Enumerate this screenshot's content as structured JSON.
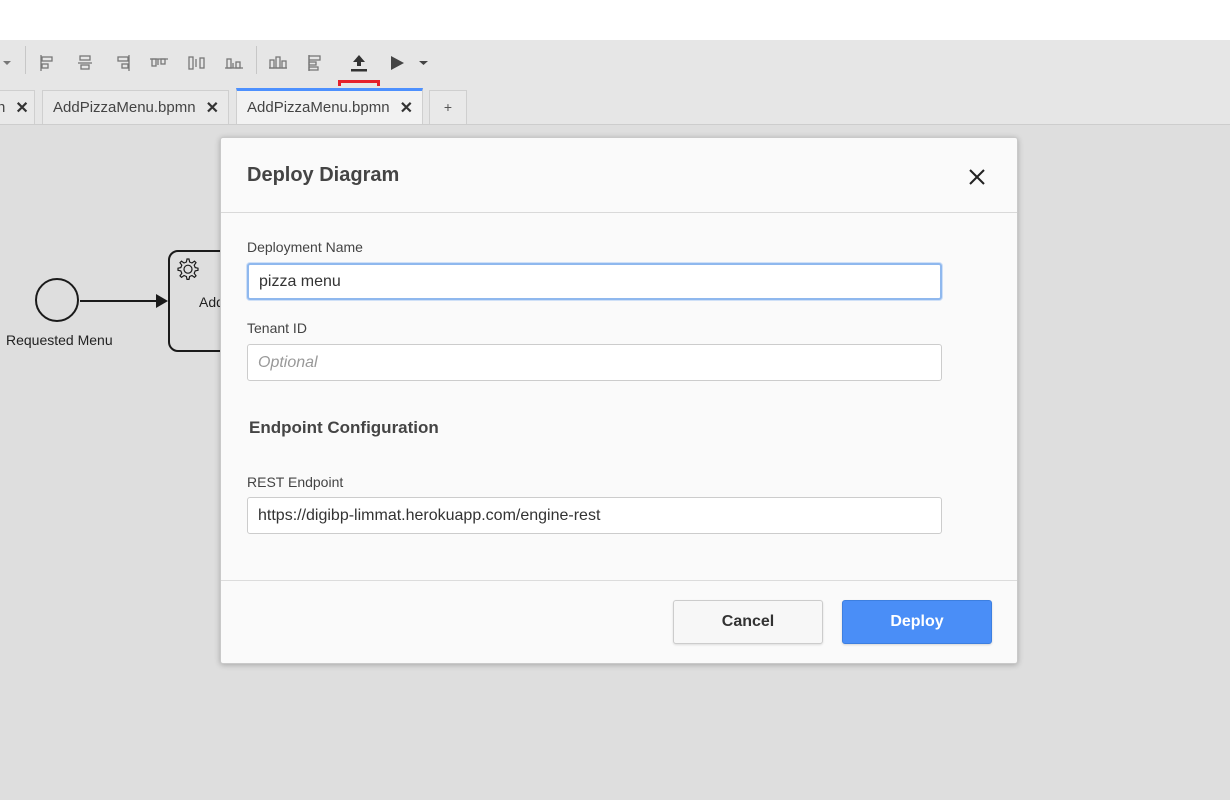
{
  "toolbar": {
    "icons": [
      "dropdown-caret-icon",
      "align-left-icon",
      "align-center-icon",
      "align-right-icon",
      "align-top-icon",
      "align-middle-icon",
      "align-bottom-icon",
      "distribute-horizontal-icon",
      "distribute-vertical-icon",
      "deploy-icon",
      "run-icon",
      "run-dropdown-icon"
    ],
    "highlight_color": "#e5202a"
  },
  "tabs": [
    {
      "label": "n",
      "closable": true
    },
    {
      "label": "AddPizzaMenu.bpmn",
      "closable": true
    },
    {
      "label": "AddPizzaMenu.bpmn",
      "closable": true,
      "active": true
    }
  ],
  "tab_add_label": "+",
  "tab_close_glyph": "✕",
  "diagram": {
    "start_event_label": "Requested Menu",
    "task_label": "Add"
  },
  "dialog": {
    "title": "Deploy Diagram",
    "deployment_name_label": "Deployment Name",
    "deployment_name_value": "pizza menu",
    "tenant_id_label": "Tenant ID",
    "tenant_id_placeholder": "Optional",
    "tenant_id_value": "",
    "section_title": "Endpoint Configuration",
    "rest_endpoint_label": "REST Endpoint",
    "rest_endpoint_value": "https://digibp-limmat.herokuapp.com/engine-rest",
    "cancel_label": "Cancel",
    "deploy_label": "Deploy"
  },
  "colors": {
    "accent": "#4a8ef7",
    "tab_active_border": "#4d90fe",
    "canvas_bg": "#dedede"
  }
}
